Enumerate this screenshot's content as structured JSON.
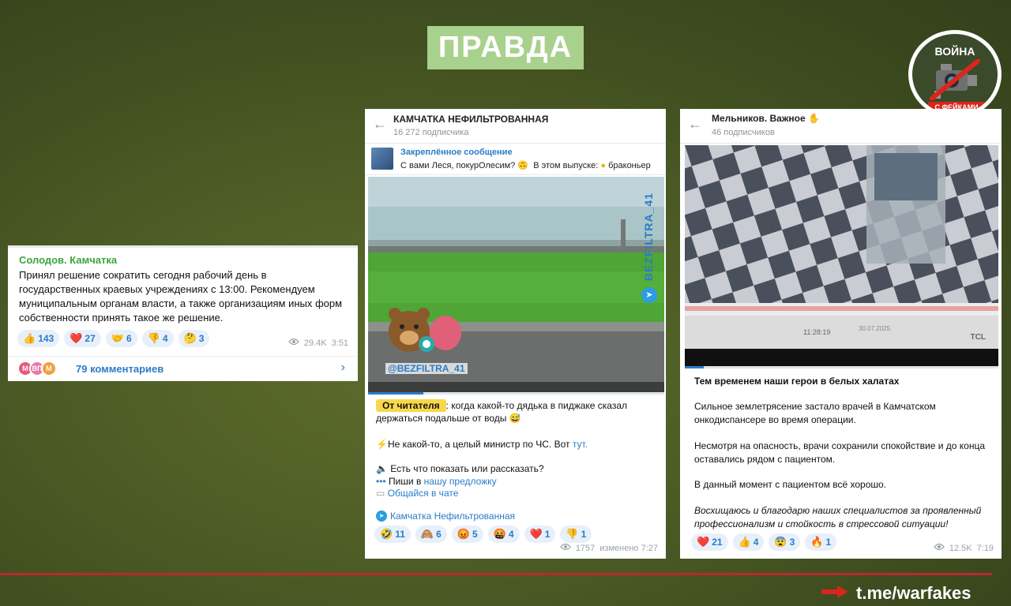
{
  "title": "ПРАВДА",
  "logo": {
    "top_text": "ВОЙНА",
    "bottom_text": "С ФЕЙКАМИ"
  },
  "footer": {
    "link": "t.me/warfakes"
  },
  "colors": {
    "title_bg": "#a9d18e",
    "footer_line": "#c0262d",
    "accent_blue": "#2a7cc7",
    "author_green": "#3ba63b"
  },
  "post1": {
    "author": "Солодов. Камчатка",
    "text": "Принял решение сократить сегодня рабочий день в государственных краевых учреждениях с 13:00. Рекомендуем муниципальным органам власти, а также организациям иных форм собственности принять такое же решение.",
    "reactions": [
      {
        "icon": "thumbs-up-icon",
        "emoji": "👍",
        "count": "143"
      },
      {
        "icon": "heart-icon",
        "emoji": "❤️",
        "count": "27"
      },
      {
        "icon": "handshake-icon",
        "emoji": "🤝",
        "count": "6"
      },
      {
        "icon": "thumbs-down-icon",
        "emoji": "👎",
        "count": "4"
      },
      {
        "icon": "thinking-face-icon",
        "emoji": "🤔",
        "count": "3"
      }
    ],
    "views": "29.4K",
    "time": "3:51",
    "avatars": [
      "М",
      "ВП",
      "М"
    ],
    "comments": "79 комментариев"
  },
  "post2": {
    "channel": "КАМЧАТКА НЕФИЛЬТРОВАННАЯ",
    "subscribers": "16 272 подписчика",
    "pinned_label": "Закреплённое сообщение",
    "pinned_text_a": "С вами Леся, покурОлесим?",
    "pinned_text_b": "В этом выпуске:",
    "pinned_text_c": "браконьер",
    "watermark": "BEZFILTRA_41",
    "watermark_sticker": "@BEZFILTRA_41",
    "reader_badge": "От читателя",
    "text_1": ": когда какой-то дядька в пиджаке сказал держаться подальше от воды",
    "text_2a": "Не какой-то, а целый министр по ЧС. Вот",
    "text_2b": "тут.",
    "text_3": "Есть что показать или рассказать?",
    "text_4a": "Пиши в",
    "text_4b": "нашу предложку",
    "text_5": "Общайся в чате",
    "signature": "Камчатка Нефильтрованная",
    "reactions": [
      {
        "icon": "rofl-icon",
        "emoji": "🤣",
        "count": "11"
      },
      {
        "icon": "see-no-evil-monkey-icon",
        "emoji": "🙈",
        "count": "6"
      },
      {
        "icon": "angry-face-icon",
        "emoji": "😡",
        "count": "5"
      },
      {
        "icon": "cursing-face-icon",
        "emoji": "🤬",
        "count": "4"
      },
      {
        "icon": "heart-icon",
        "emoji": "❤️",
        "count": "1"
      },
      {
        "icon": "thumbs-down-icon",
        "emoji": "👎",
        "count": "1"
      }
    ],
    "views": "1757",
    "edited": "изменено 7:27"
  },
  "post3": {
    "channel": "Мельников. Важное",
    "subscribers": "46 подписчиков",
    "video_overlay_date": "30.07.2025",
    "video_overlay_time": "11:28:19",
    "video_overlay_brand": "TCL",
    "headline": "Тем временем наши герои в белых халатах",
    "para_1": "Сильное землетрясение застало врачей в Камчатском онкодиспансере во время операции.",
    "para_2": "Несмотря на опасность, врачи сохранили спокойствие и до конца оставались рядом с пациентом.",
    "para_3": "В данный момент с пациентом всё хорошо.",
    "para_4": "Восхищаюсь и благодарю наших специалистов за проявленный профессионализм и стойкость в стрессовой ситуации!",
    "reactions": [
      {
        "icon": "heart-icon",
        "emoji": "❤️",
        "count": "21"
      },
      {
        "icon": "thumbs-up-icon",
        "emoji": "👍",
        "count": "4"
      },
      {
        "icon": "fearful-face-icon",
        "emoji": "😨",
        "count": "3"
      },
      {
        "icon": "fire-icon",
        "emoji": "🔥",
        "count": "1"
      }
    ],
    "views": "12.5K",
    "time": "7:19"
  }
}
